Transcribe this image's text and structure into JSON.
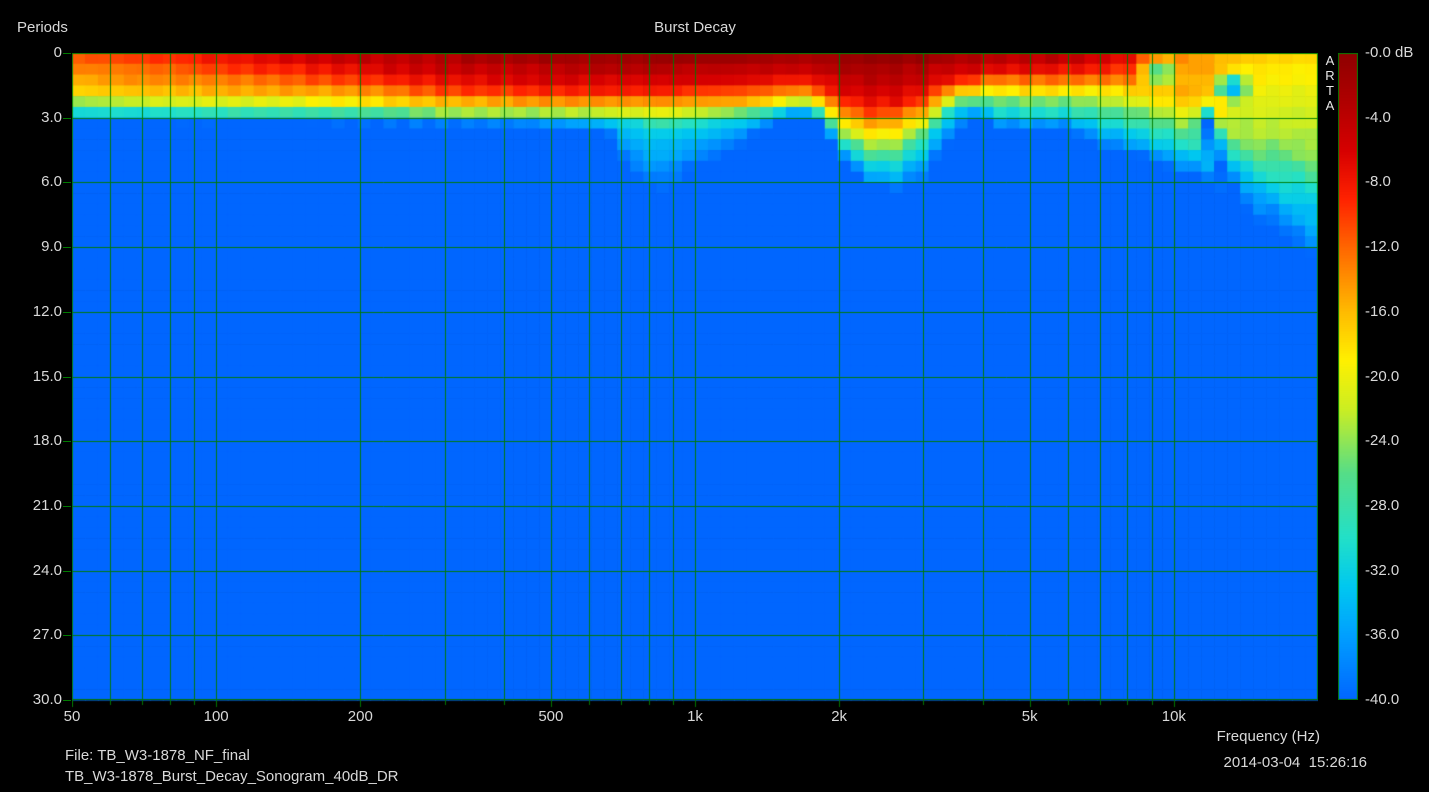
{
  "header": {
    "title": "Burst Decay"
  },
  "axes": {
    "y_title": "Periods",
    "x_title": "Frequency (Hz)"
  },
  "watermark": {
    "text": "ARTA"
  },
  "footer": {
    "file_line1": "File: TB_W3-1878_NF_final",
    "file_line2": "TB_W3-1878_Burst_Decay_Sonogram_40dB_DR",
    "timestamp": "2014-03-04  15:26:16"
  },
  "colors": {
    "background": "#000000",
    "grid": "#007a00",
    "text": "#d9d9d9",
    "floor_blue": "#0066ff"
  },
  "chart_data": {
    "type": "heatmap",
    "title": "Burst Decay",
    "xlabel": "Frequency (Hz)",
    "ylabel": "Periods",
    "x_scale": "log",
    "x_range_hz": [
      50,
      20000
    ],
    "y_range_periods": [
      0,
      30
    ],
    "value_range_db": [
      0,
      -40
    ],
    "grid": "on",
    "x_ticks": [
      {
        "label": "50",
        "hz": 50
      },
      {
        "label": "100",
        "hz": 100
      },
      {
        "label": "200",
        "hz": 200
      },
      {
        "label": "500",
        "hz": 500
      },
      {
        "label": "1k",
        "hz": 1000
      },
      {
        "label": "2k",
        "hz": 2000
      },
      {
        "label": "5k",
        "hz": 5000
      },
      {
        "label": "10k",
        "hz": 10000
      }
    ],
    "grid_hz": [
      60,
      70,
      80,
      90,
      100,
      200,
      300,
      400,
      500,
      600,
      700,
      800,
      900,
      1000,
      2000,
      3000,
      4000,
      5000,
      6000,
      7000,
      8000,
      9000,
      10000
    ],
    "y_ticks": [
      "0",
      "3.0",
      "6.0",
      "9.0",
      "12.0",
      "15.0",
      "18.0",
      "21.0",
      "24.0",
      "27.0",
      "30.0"
    ],
    "y_tick_periods": [
      0,
      3,
      6,
      9,
      12,
      15,
      18,
      21,
      24,
      27,
      30
    ],
    "colorbar_ticks": [
      "-0.0 dB",
      "-4.0",
      "-8.0",
      "-12.0",
      "-16.0",
      "-20.0",
      "-24.0",
      "-28.0",
      "-32.0",
      "-36.0",
      "-40.0"
    ],
    "colormap_db_hex": [
      [
        0,
        "#8F0000"
      ],
      [
        -3,
        "#B00000"
      ],
      [
        -6,
        "#D60000"
      ],
      [
        -9,
        "#FF2200"
      ],
      [
        -12,
        "#FF6600"
      ],
      [
        -16,
        "#FFBB00"
      ],
      [
        -19,
        "#FFF000"
      ],
      [
        -22,
        "#CCEE22"
      ],
      [
        -26,
        "#55DD88"
      ],
      [
        -30,
        "#22E0C8"
      ],
      [
        -33,
        "#00C8F0"
      ],
      [
        -36,
        "#00A0FF"
      ],
      [
        -40,
        "#0066FF"
      ]
    ],
    "profile_format": "[freq_hz, level0_db, periods_to_-8dB, periods_to_-16dB, periods_to_-24dB, periods_to_-32dB, periods_to_-40dB]",
    "decay_profiles": [
      [
        50,
        -11,
        0,
        1.6,
        2.3,
        2.8,
        3.15
      ],
      [
        80,
        -8.5,
        0,
        1.8,
        2.45,
        2.85,
        3.2
      ],
      [
        100,
        -7,
        0.3,
        1.85,
        2.5,
        2.9,
        3.2
      ],
      [
        150,
        -5,
        0.7,
        1.95,
        2.55,
        2.9,
        3.2
      ],
      [
        200,
        -3.5,
        1.0,
        2.05,
        2.6,
        2.95,
        3.25
      ],
      [
        300,
        -2,
        1.5,
        2.3,
        2.75,
        3.0,
        3.3
      ],
      [
        500,
        -1,
        1.7,
        2.4,
        2.8,
        3.05,
        3.35
      ],
      [
        650,
        -0.5,
        1.7,
        2.45,
        2.85,
        3.1,
        3.5
      ],
      [
        750,
        0,
        1.7,
        2.45,
        2.9,
        3.3,
        5.9
      ],
      [
        850,
        0,
        1.7,
        2.5,
        2.95,
        3.6,
        6.45
      ],
      [
        1000,
        0,
        1.6,
        2.4,
        2.85,
        3.4,
        5.3
      ],
      [
        1200,
        0,
        1.55,
        2.35,
        2.75,
        3.1,
        4.5
      ],
      [
        1450,
        -0.5,
        1.4,
        2.15,
        2.55,
        2.85,
        3.2
      ],
      [
        1650,
        -1,
        1.2,
        1.9,
        2.3,
        2.55,
        2.85
      ],
      [
        1850,
        -0.5,
        1.5,
        2.2,
        2.6,
        2.9,
        3.2
      ],
      [
        2000,
        0,
        2.0,
        2.9,
        3.6,
        4.2,
        4.7
      ],
      [
        2300,
        0,
        2.5,
        3.4,
        4.35,
        5.2,
        6.2
      ],
      [
        2600,
        0,
        2.45,
        3.35,
        4.35,
        5.4,
        6.45
      ],
      [
        3000,
        0,
        1.9,
        2.8,
        3.5,
        4.4,
        5.9
      ],
      [
        3400,
        -1,
        1.25,
        1.85,
        2.3,
        2.75,
        4.1
      ],
      [
        3800,
        -1,
        1.1,
        1.65,
        2.1,
        2.5,
        2.95
      ],
      [
        4300,
        -2,
        0.85,
        1.5,
        2.15,
        2.8,
        3.5
      ],
      [
        5000,
        -2,
        0.9,
        1.6,
        2.2,
        2.9,
        3.6
      ],
      [
        6000,
        -3,
        0.85,
        1.55,
        2.2,
        2.85,
        3.5
      ],
      [
        7000,
        -5,
        0.75,
        1.5,
        2.3,
        3.3,
        4.4
      ],
      [
        8000,
        -7,
        0.6,
        1.6,
        2.5,
        3.6,
        4.7
      ],
      [
        9000,
        -10,
        0,
        1.8,
        2.8,
        4.0,
        5.0
      ],
      [
        10500,
        -13,
        0,
        2.1,
        3.3,
        4.6,
        5.6
      ],
      [
        12000,
        -15,
        0,
        2.3,
        3.6,
        4.9,
        6.1
      ],
      [
        14000,
        -16.5,
        0,
        2.5,
        4.0,
        5.6,
        7.4
      ],
      [
        17000,
        -17.5,
        0,
        2.7,
        4.4,
        6.3,
        8.6
      ],
      [
        20000,
        -18,
        0,
        2.9,
        4.7,
        7.0,
        9.6
      ]
    ],
    "spot_format": "[freq_hz, period, level_db, radius_log10f, radius_periods]",
    "spots": [
      [
        9400,
        0.95,
        -26,
        0.03,
        0.55
      ],
      [
        13200,
        1.6,
        -34,
        0.028,
        0.5
      ],
      [
        11600,
        3.4,
        -40,
        0.014,
        0.8
      ],
      [
        12100,
        4.3,
        -40,
        0.014,
        0.8
      ],
      [
        12700,
        5.4,
        -40,
        0.014,
        0.8
      ],
      [
        13300,
        6.5,
        -40,
        0.014,
        0.8
      ],
      [
        14000,
        7.6,
        -40,
        0.014,
        0.8
      ]
    ]
  }
}
